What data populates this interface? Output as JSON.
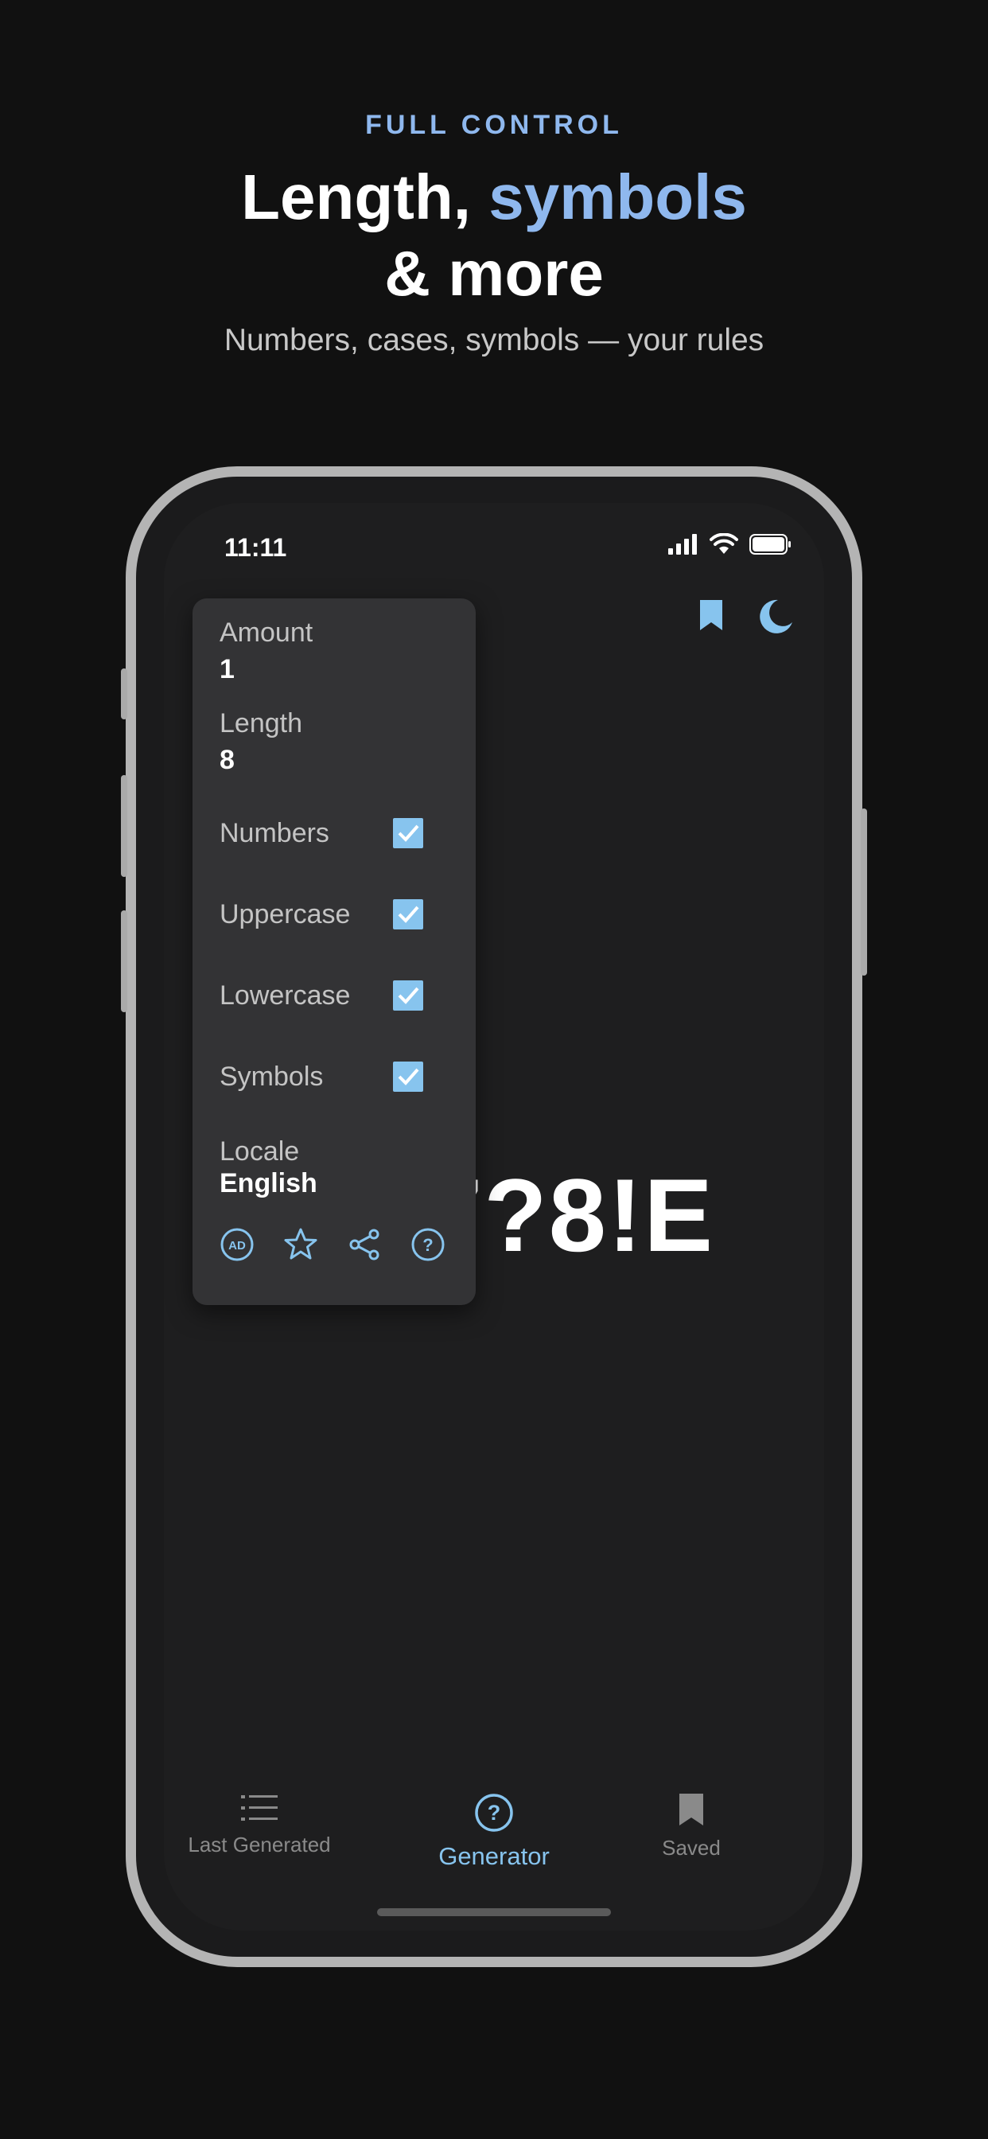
{
  "hero": {
    "eyebrow": "FULL CONTROL",
    "title_part1": "Length, ",
    "title_accent": "symbols",
    "title_line2": "& more",
    "subtitle": "Numbers, cases, symbols — your rules"
  },
  "status_bar": {
    "time": "11:11"
  },
  "password_display": "7?8!E",
  "menu": {
    "amount_label": "Amount",
    "amount_value": "1",
    "length_label": "Length",
    "length_value": "8",
    "options": [
      {
        "label": "Numbers",
        "checked": true
      },
      {
        "label": "Uppercase",
        "checked": true
      },
      {
        "label": "Lowercase",
        "checked": true
      },
      {
        "label": "Symbols",
        "checked": true
      }
    ],
    "locale_label": "Locale",
    "locale_value": "English",
    "ad_icon_text": "AD"
  },
  "tabs": [
    {
      "label": "Last Generated",
      "icon": "list-icon",
      "active": false
    },
    {
      "label": "Generator",
      "icon": "question-circle-icon",
      "active": true
    },
    {
      "label": "Saved",
      "icon": "bookmark-icon",
      "active": false
    }
  ],
  "colors": {
    "accent": "#87c4ee",
    "hero_accent": "#8fb8ee",
    "background": "#111111"
  }
}
